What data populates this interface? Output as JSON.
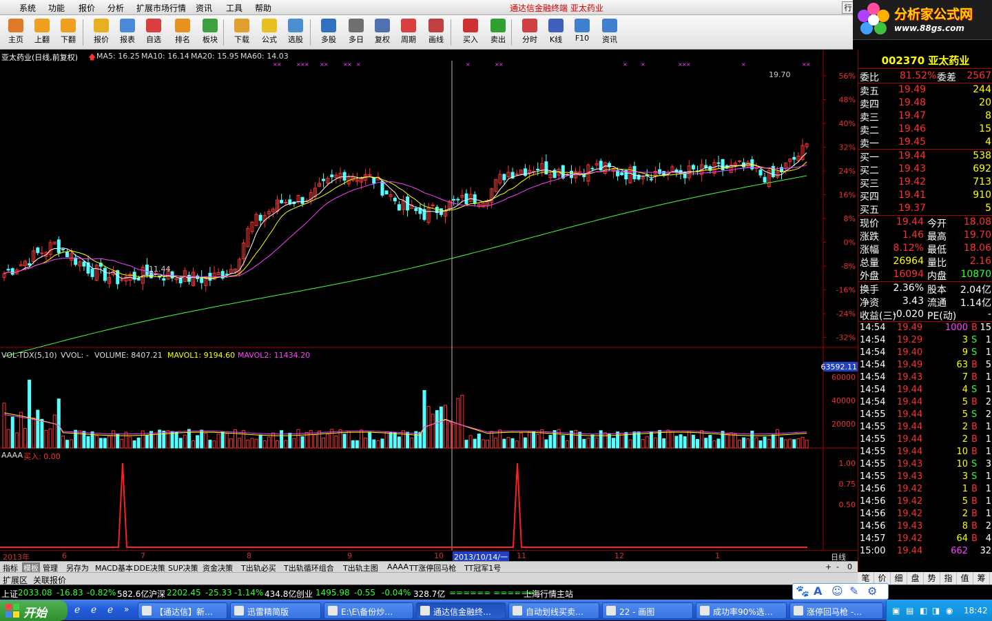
{
  "menu": [
    "系统",
    "功能",
    "报价",
    "分析",
    "扩展市场行情",
    "资讯",
    "工具",
    "帮助"
  ],
  "window_title": "通达信金融终端    亚太药业",
  "right_button": "行",
  "logo": {
    "line1": "分析家公式网",
    "line2": "www.88gs.com"
  },
  "toolbar": [
    {
      "label": "主页",
      "icon": "home-icon",
      "color": "#e07a2a"
    },
    {
      "label": "上翻",
      "icon": "arrow-up-icon",
      "color": "#f0a020"
    },
    {
      "label": "下翻",
      "icon": "arrow-down-icon",
      "color": "#f0a020"
    },
    {
      "label": "报价",
      "icon": "yen-icon",
      "color": "#e8b020"
    },
    {
      "label": "报表",
      "icon": "report-icon",
      "color": "#4a8ad8"
    },
    {
      "label": "自选",
      "icon": "f6-icon",
      "color": "#d84040"
    },
    {
      "label": "排名",
      "icon": "ranking-icon",
      "color": "#e89020"
    },
    {
      "label": "板块",
      "icon": "blocks-icon",
      "color": "#3aa040"
    },
    {
      "label": "下载",
      "icon": "download-icon",
      "color": "#e0a030"
    },
    {
      "label": "公式",
      "icon": "formula-icon",
      "color": "#e8c020"
    },
    {
      "label": "选股",
      "icon": "select-stock-icon",
      "color": "#4a90d0"
    },
    {
      "label": "多股",
      "icon": "multi-stock-icon",
      "color": "#3070c0"
    },
    {
      "label": "多日",
      "icon": "clock-icon",
      "color": "#707070"
    },
    {
      "label": "复权",
      "icon": "restore-icon",
      "color": "#5070b0"
    },
    {
      "label": "周期",
      "icon": "f8-icon",
      "color": "#d84040"
    },
    {
      "label": "画线",
      "icon": "pen-icon",
      "color": "#c04040"
    },
    {
      "label": "买入",
      "icon": "buy-icon",
      "color": "#d03030"
    },
    {
      "label": "卖出",
      "icon": "sell-icon",
      "color": "#30a030"
    },
    {
      "label": "分时",
      "icon": "intraday-icon",
      "color": "#d04040"
    },
    {
      "label": "K线",
      "icon": "kline-icon",
      "color": "#4060c0"
    },
    {
      "label": "F10",
      "icon": "f10-icon",
      "color": "#4080d0"
    },
    {
      "label": "资讯",
      "icon": "news-icon",
      "color": "#4080d0"
    }
  ],
  "kline": {
    "stock_title": "亚太药业(日线,前复权)",
    "ma": [
      {
        "label": "MA5: 16.25",
        "color": "#ffffff"
      },
      {
        "label": "MA10: 16.14",
        "color": "#ffff00"
      },
      {
        "label": "MA20: 15.95",
        "color": "#ff40ff"
      },
      {
        "label": "MA60: 14.03",
        "color": "#40ff40"
      }
    ],
    "price_axis": [
      "56%",
      "48%",
      "40%",
      "32%",
      "24%",
      "16%",
      "8%",
      "0%",
      "-8%",
      "-16%",
      "-24%",
      "-32%"
    ],
    "high_label": "19.70",
    "low_label": "11.44",
    "volume_header": {
      "name": "VOL-TDX(5,10)",
      "vvol": "VVOL: -",
      "volume": "VOLUME: 8407.21",
      "mavol1": "MAVOL1: 9194.60",
      "mavol2": "MAVOL2: 11434.20"
    },
    "volume_axis": [
      "60000",
      "40000",
      "20000"
    ],
    "volume_cursor": "63592.11",
    "aaaa_header": {
      "name": "AAAA",
      "signal": "买入: 0.00"
    },
    "aaaa_axis": [
      "1.00",
      "0.75",
      "0.50"
    ],
    "time_axis": [
      "2013年",
      "6",
      "7",
      "8",
      "9",
      "10",
      "2013/10/14/一",
      "11",
      "12",
      "1"
    ],
    "period_label": "日线"
  },
  "tabs": [
    "指标",
    "模板",
    "管理",
    "另存为",
    "MACD基本",
    "DDE决策",
    "SUP决策",
    "资金决策",
    "T出轨必买",
    "T出轨循环组合",
    "T出轨主图",
    "AAAA",
    "TT涨停回马枪",
    "TT冠军1号"
  ],
  "tabs_right": [
    "+",
    "-",
    "0"
  ],
  "bottom_tabs": [
    "扩展区",
    "关联报价"
  ],
  "quote": {
    "code_name": "002370 亚太药业",
    "wei": {
      "l1": "委比",
      "v1": "81.52%",
      "l2": "委差",
      "v2": "2567"
    },
    "sell": [
      {
        "l": "卖五",
        "p": "19.49",
        "v": "244"
      },
      {
        "l": "卖四",
        "p": "19.48",
        "v": "20"
      },
      {
        "l": "卖三",
        "p": "19.47",
        "v": "8"
      },
      {
        "l": "卖二",
        "p": "19.46",
        "v": "15"
      },
      {
        "l": "卖一",
        "p": "19.45",
        "v": "4"
      }
    ],
    "buy": [
      {
        "l": "买一",
        "p": "19.44",
        "v": "538"
      },
      {
        "l": "买二",
        "p": "19.43",
        "v": "692"
      },
      {
        "l": "买三",
        "p": "19.42",
        "v": "713"
      },
      {
        "l": "买四",
        "p": "19.41",
        "v": "910"
      },
      {
        "l": "买五",
        "p": "19.37",
        "v": "5"
      }
    ],
    "stats": [
      {
        "l1": "现价",
        "v1": "19.44",
        "c1": "#ff3030",
        "l2": "今开",
        "v2": "18.08",
        "c2": "#ff3030"
      },
      {
        "l1": "涨跌",
        "v1": "1.46",
        "c1": "#ff3030",
        "l2": "最高",
        "v2": "19.70",
        "c2": "#ff3030"
      },
      {
        "l1": "涨幅",
        "v1": "8.12%",
        "c1": "#ff3030",
        "l2": "最低",
        "v2": "18.06",
        "c2": "#ff3030"
      },
      {
        "l1": "总量",
        "v1": "26964",
        "c1": "#ffff00",
        "l2": "量比",
        "v2": "2.16",
        "c2": "#ff3030"
      },
      {
        "l1": "外盘",
        "v1": "16094",
        "c1": "#ff3030",
        "l2": "内盘",
        "v2": "10870",
        "c2": "#30ff30"
      }
    ],
    "stats2": [
      {
        "l1": "换手",
        "v1": "2.36%",
        "c1": "#ffffff",
        "l2": "股本",
        "v2": "2.04亿",
        "c2": "#ffffff"
      },
      {
        "l1": "净资",
        "v1": "3.43",
        "c1": "#ffffff",
        "l2": "流通",
        "v2": "1.14亿",
        "c2": "#ffffff"
      },
      {
        "l1": "收益(三)",
        "v1": "-0.020",
        "c1": "#ffffff",
        "l2": "PE(动)",
        "v2": "-",
        "c2": "#ffffff"
      }
    ],
    "ticks": [
      {
        "t": "14:54",
        "p": "19.49",
        "v": "1000",
        "d": "B",
        "n": "15",
        "vc": "#ff40ff"
      },
      {
        "t": "14:54",
        "p": "19.29",
        "v": "3",
        "d": "S",
        "n": "1"
      },
      {
        "t": "14:54",
        "p": "19.40",
        "v": "9",
        "d": "S",
        "n": "1"
      },
      {
        "t": "14:54",
        "p": "19.49",
        "v": "63",
        "d": "B",
        "n": "5"
      },
      {
        "t": "14:54",
        "p": "19.43",
        "v": "7",
        "d": "B",
        "n": "1"
      },
      {
        "t": "14:54",
        "p": "19.44",
        "v": "4",
        "d": "S",
        "n": "1"
      },
      {
        "t": "14:54",
        "p": "19.44",
        "v": "5",
        "d": "B",
        "n": "2"
      },
      {
        "t": "14:55",
        "p": "19.44",
        "v": "5",
        "d": "S",
        "n": "2"
      },
      {
        "t": "14:55",
        "p": "19.44",
        "v": "2",
        "d": "B",
        "n": "1"
      },
      {
        "t": "14:55",
        "p": "19.44",
        "v": "2",
        "d": "B",
        "n": "1"
      },
      {
        "t": "14:55",
        "p": "19.44",
        "v": "10",
        "d": "B",
        "n": "1"
      },
      {
        "t": "14:55",
        "p": "19.43",
        "v": "10",
        "d": "S",
        "n": "3"
      },
      {
        "t": "14:55",
        "p": "19.43",
        "v": "3",
        "d": "S",
        "n": "1"
      },
      {
        "t": "14:56",
        "p": "19.42",
        "v": "1",
        "d": "B",
        "n": "1"
      },
      {
        "t": "14:56",
        "p": "19.42",
        "v": "5",
        "d": "B",
        "n": "1"
      },
      {
        "t": "14:56",
        "p": "19.42",
        "v": "2",
        "d": "B",
        "n": "1"
      },
      {
        "t": "14:56",
        "p": "19.43",
        "v": "8",
        "d": "B",
        "n": "2"
      },
      {
        "t": "14:57",
        "p": "19.42",
        "v": "64",
        "d": "B",
        "n": "4"
      },
      {
        "t": "15:00",
        "p": "19.44",
        "v": "662",
        "d": "",
        "n": "32",
        "vc": "#ff40ff"
      }
    ]
  },
  "right_tabs": [
    "笔",
    "价",
    "细",
    "盘",
    "势",
    "指",
    "值",
    "筹"
  ],
  "status": {
    "sh": {
      "name": "上证",
      "v": "2033.08",
      "ch": "-16.83",
      "pct": "-0.82%",
      "amt": "582.6亿"
    },
    "hs": {
      "name": "沪深",
      "v": "2202.45",
      "ch": "-25.33",
      "pct": "-1.14%",
      "amt": "434.8亿"
    },
    "cy": {
      "name": "创业",
      "v": "1495.98",
      "ch": "-0.55",
      "pct": "-0.04%",
      "amt": "328.7亿"
    },
    "indicator": "======  ======",
    "server": "上海行情主站"
  },
  "taskbar": {
    "start": "开始",
    "items": [
      "【通达信】新…",
      "迅雷精简版",
      "E:\\E\\备份炒…",
      "通达信金融终…",
      "自动划线买卖…",
      "22 - 画图",
      "成功率90%选…",
      "涨停回马枪 -…"
    ],
    "clock": "18:42"
  }
}
